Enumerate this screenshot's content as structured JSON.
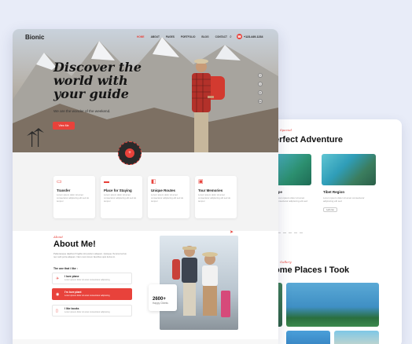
{
  "colors": {
    "accent": "#e8423b",
    "text": "#111111",
    "muted": "#999999",
    "bg": "#e8ecf8"
  },
  "nav": {
    "logo": "Bionic",
    "items": [
      "HOME",
      "ABOUT",
      "PAGES",
      "PORTFOLIO",
      "BLOG",
      "CONTACT"
    ],
    "active": "HOME",
    "search_icon": "search-icon",
    "phone": "+123-449-1234"
  },
  "hero": {
    "title": "Discover the world with your guide",
    "subtitle": "We are the wonder of the weekend.",
    "button": "View Me",
    "social": [
      "f",
      "t",
      "in",
      "be"
    ],
    "badge_icon": "arrow-icon"
  },
  "features": [
    {
      "icon": "car-icon",
      "title": "Transfer",
      "desc": "Lorem ipsum dolor sit amet consectetur adipiscing elit sed do tempor"
    },
    {
      "icon": "bed-icon",
      "title": "Place for Staying",
      "desc": "Lorem ipsum dolor sit amet consectetur adipiscing elit sed do tempor"
    },
    {
      "icon": "route-icon",
      "title": "Unique Routes",
      "desc": "Lorem ipsum dolor sit amet consectetur adipiscing elit sed do tempor"
    },
    {
      "icon": "photo-icon",
      "title": "Tour Memories",
      "desc": "Lorem ipsum dolor sit amet consectetur adipiscing elit sed do tempor"
    }
  ],
  "about": {
    "tag": "About",
    "title": "About Me!",
    "text": "Pellentesque dapibus fringilla nisl pretium aliquam. Quisque rhoncus lectus nec velit porta aliquam. Nam nunc lorem faucibus quis luctus in.",
    "likes_title": "The one that i like :",
    "likes": [
      {
        "icon": "plane-icon",
        "title": "I love plane",
        "desc": "Lorem ipsum dolor sit amet consectetur adipiscing"
      },
      {
        "icon": "pin-icon",
        "title": "I'm love plant",
        "desc": "Lorem ipsum dolor sit amet consectetur adipiscing"
      },
      {
        "icon": "book-icon",
        "title": "I like books",
        "desc": "Lorem ipsum dolor sit amet consectetur adipiscing"
      }
    ],
    "stat_number": "2600+",
    "stat_caption": "Happy Clients"
  },
  "right": {
    "subtag": "Special",
    "heading": "erfect Adventure",
    "cards": [
      {
        "title": "ope",
        "desc": "Lorem ipsum dolor sit amet consectetur adipiscing elit sed"
      },
      {
        "title": "Tibet Region",
        "desc": "Lorem ipsum dolor sit amet consectetur adipiscing elit sed",
        "btn": "Let's Go"
      }
    ],
    "gallery_tag": "Gallery",
    "heading2": "ome Places I Took"
  }
}
